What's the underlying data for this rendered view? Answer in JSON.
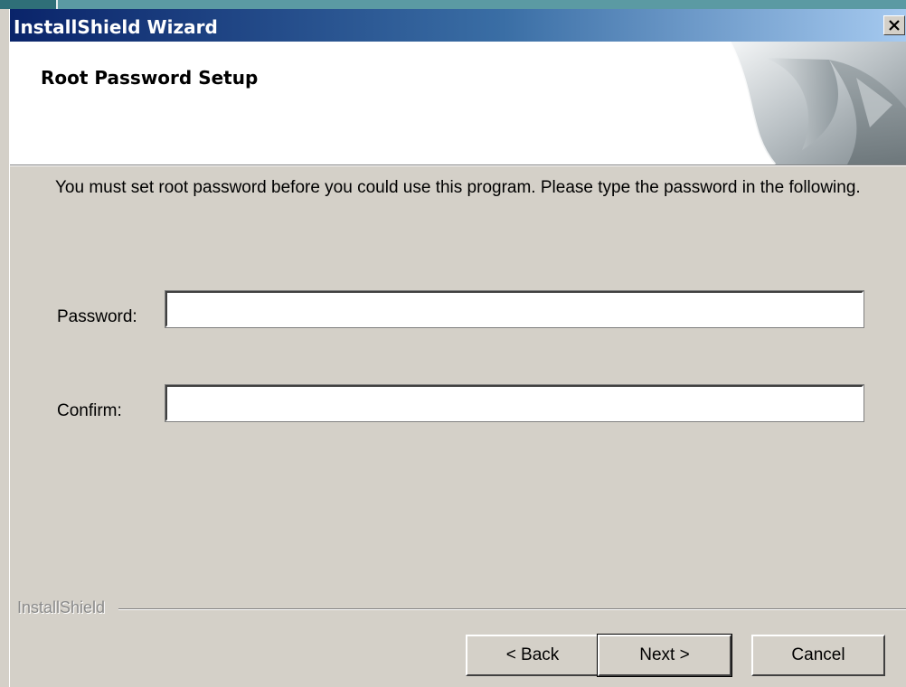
{
  "window": {
    "title": "InstallShield Wizard",
    "close_label": "×"
  },
  "header": {
    "title": "Root Password Setup"
  },
  "content": {
    "description": "You must set root password before you could use this program. Please type the password in the following.",
    "password_label": "Password:",
    "password_value": "",
    "confirm_label": "Confirm:",
    "confirm_value": ""
  },
  "footer": {
    "brand": "InstallShield",
    "back_label": "< Back",
    "next_label": "Next >",
    "cancel_label": "Cancel"
  },
  "colors": {
    "titlebar_start": "#0a246a",
    "titlebar_end": "#a6caf0",
    "dialog_face": "#d4d0c8"
  },
  "icons": {
    "close": "close-icon",
    "header_graphic": "installshield-header-graphic"
  }
}
